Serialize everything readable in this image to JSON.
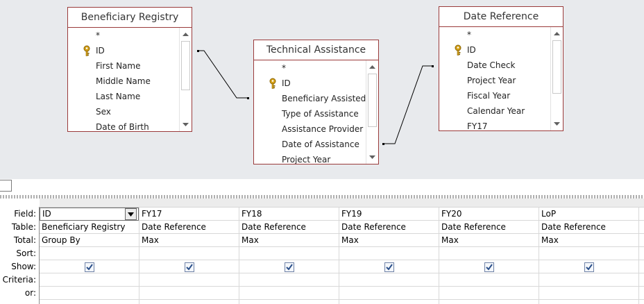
{
  "tables": [
    {
      "title": "Beneficiary Registry",
      "fields": [
        {
          "name": "*",
          "key": false
        },
        {
          "name": "ID",
          "key": true
        },
        {
          "name": "First Name",
          "key": false
        },
        {
          "name": "Middle Name",
          "key": false
        },
        {
          "name": "Last Name",
          "key": false
        },
        {
          "name": "Sex",
          "key": false
        },
        {
          "name": "Date of Birth",
          "key": false
        }
      ]
    },
    {
      "title": "Technical Assistance",
      "fields": [
        {
          "name": "*",
          "key": false
        },
        {
          "name": "ID",
          "key": true
        },
        {
          "name": "Beneficiary Assisted",
          "key": false
        },
        {
          "name": "Type of Assistance",
          "key": false
        },
        {
          "name": "Assistance Provider",
          "key": false
        },
        {
          "name": "Date of Assistance",
          "key": false
        },
        {
          "name": "Project Year",
          "key": false
        }
      ]
    },
    {
      "title": "Date Reference",
      "fields": [
        {
          "name": "*",
          "key": false
        },
        {
          "name": "ID",
          "key": true
        },
        {
          "name": "Date Check",
          "key": false
        },
        {
          "name": "Project Year",
          "key": false
        },
        {
          "name": "Fiscal Year",
          "key": false
        },
        {
          "name": "Calendar Year",
          "key": false
        },
        {
          "name": "FY17",
          "key": false
        }
      ]
    }
  ],
  "grid": {
    "row_labels": [
      "Field:",
      "Table:",
      "Total:",
      "Sort:",
      "Show:",
      "Criteria:",
      "or:"
    ],
    "columns": [
      {
        "field": "ID",
        "table": "Beneficiary Registry",
        "total": "Group By",
        "sort": "",
        "show": true,
        "criteria": "",
        "or": ""
      },
      {
        "field": "FY17",
        "table": "Date Reference",
        "total": "Max",
        "sort": "",
        "show": true,
        "criteria": "",
        "or": ""
      },
      {
        "field": "FY18",
        "table": "Date Reference",
        "total": "Max",
        "sort": "",
        "show": true,
        "criteria": "",
        "or": ""
      },
      {
        "field": "FY19",
        "table": "Date Reference",
        "total": "Max",
        "sort": "",
        "show": true,
        "criteria": "",
        "or": ""
      },
      {
        "field": "FY20",
        "table": "Date Reference",
        "total": "Max",
        "sort": "",
        "show": true,
        "criteria": "",
        "or": ""
      },
      {
        "field": "LoP",
        "table": "Date Reference",
        "total": "Max",
        "sort": "",
        "show": true,
        "criteria": "",
        "or": ""
      }
    ]
  },
  "colors": {
    "table_border": "#9a3a3a",
    "pane_background": "#e8eaed",
    "checkbox_tick": "#2a4f8a",
    "key_icon": "#d4a017"
  },
  "icons": {
    "primary_key": "key-icon",
    "dropdown": "chevron-down-icon",
    "scroll_up": "arrow-up-icon",
    "scroll_down": "arrow-down-icon",
    "checkbox": "checkbox-checked-icon"
  }
}
